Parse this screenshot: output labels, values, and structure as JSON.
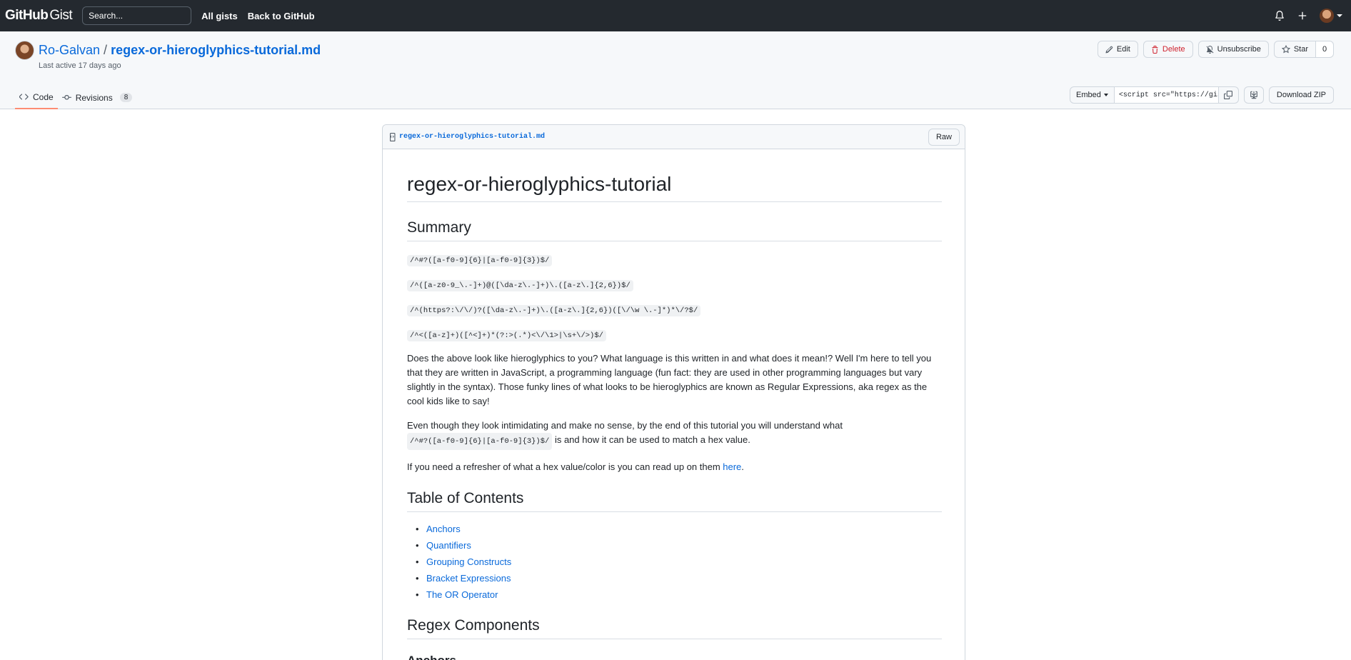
{
  "topbar": {
    "logo_main": "GitHub",
    "logo_sub": "Gist",
    "search_placeholder": "Search...",
    "all_gists": "All gists",
    "back_to_github": "Back to GitHub"
  },
  "gist": {
    "owner": "Ro-Galvan",
    "separator": "/",
    "name": "regex-or-hieroglyphics-tutorial.md",
    "last_active": "Last active 17 days ago",
    "actions": {
      "edit": "Edit",
      "delete": "Delete",
      "unsubscribe": "Unsubscribe",
      "star": "Star",
      "star_count": "0"
    },
    "tabs": [
      {
        "label": "Code"
      },
      {
        "label": "Revisions",
        "count": "8"
      }
    ],
    "embed": {
      "label": "Embed",
      "value": "<script src=\"https://gist.github.com/Ro-Galvan/",
      "download": "Download ZIP"
    }
  },
  "file": {
    "name": "regex-or-hieroglyphics-tutorial.md",
    "raw_label": "Raw"
  },
  "content": {
    "title": "regex-or-hieroglyphics-tutorial",
    "summary_heading": "Summary",
    "regexes": [
      "/^#?([a-f0-9]{6}|[a-f0-9]{3})$/",
      "/^([a-z0-9_\\.-]+)@([\\da-z\\.-]+)\\.([a-z\\.]{2,6})$/",
      "/^(https?:\\/\\/)?([\\da-z\\.-]+)\\.([a-z\\.]{2,6})([\\/\\w \\.-]*)*\\/?$/",
      "/^<([a-z]+)([^<]+)*(?:>(.*)<\\/\\1>|\\s+\\/>)$/"
    ],
    "para1": "Does the above look like hieroglyphics to you? What language is this written in and what does it mean!? Well I'm here to tell you that they are written in JavaScript, a programming language (fun fact: they are used in other programming languages but vary slightly in the syntax). Those funky lines of what looks to be hieroglyphics are known as Regular Expressions, aka regex as the cool kids like to say!",
    "para2_before": "Even though they look intimidating and make no sense, by the end of this tutorial you will understand what ",
    "para2_code": "/^#?([a-f0-9]{6}|[a-f0-9]{3})$/",
    "para2_after": " is and how it can be used to match a hex value.",
    "para3_before": "If you need a refresher of what a hex value/color is you can read up on them ",
    "para3_link": "here",
    "para3_after": ".",
    "toc_heading": "Table of Contents",
    "toc": [
      "Anchors",
      "Quantifiers",
      "Grouping Constructs",
      "Bracket Expressions",
      "The OR Operator"
    ],
    "components_heading": "Regex Components",
    "anchors_heading": "Anchors"
  }
}
